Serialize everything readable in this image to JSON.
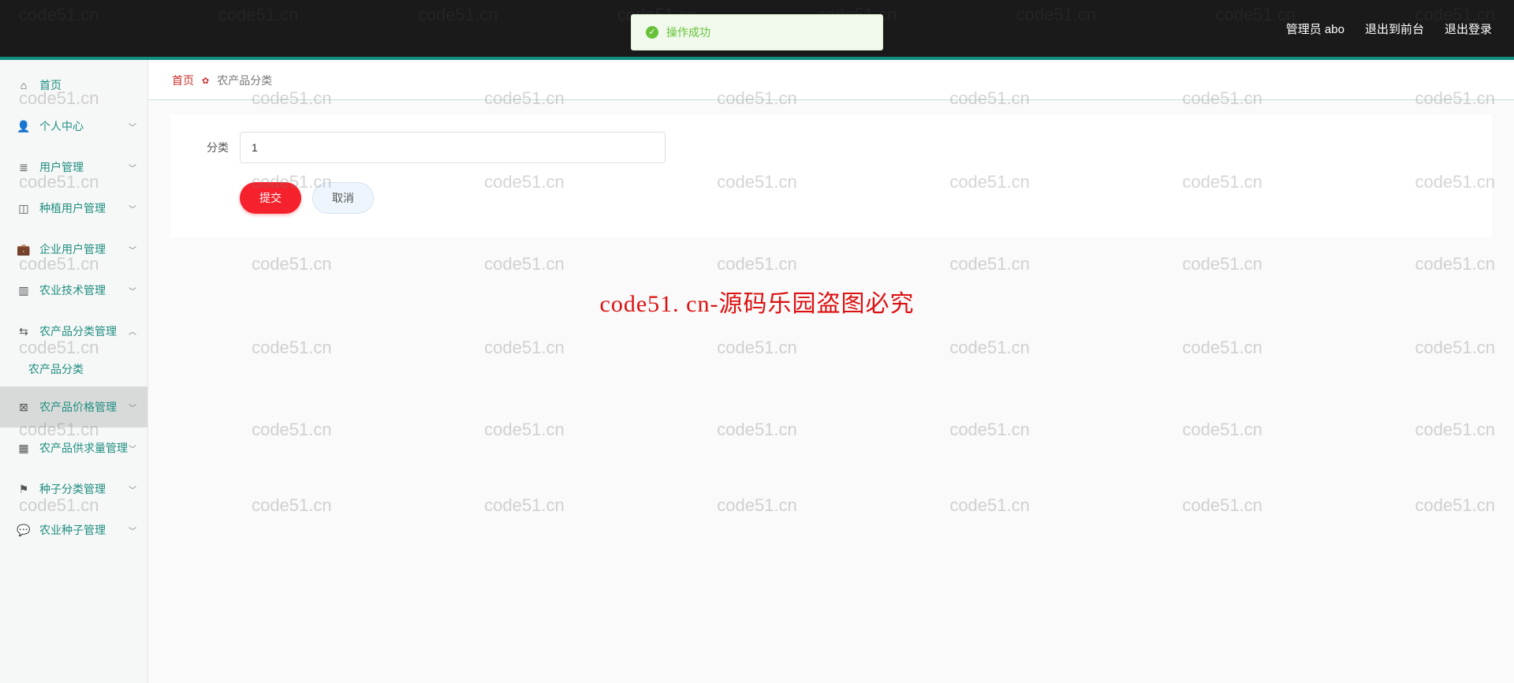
{
  "topbar": {
    "user_label": "管理员 abo",
    "to_front_label": "退出到前台",
    "logout_label": "退出登录"
  },
  "toast": {
    "message": "操作成功"
  },
  "sidebar": {
    "home_label": "首页",
    "items": [
      {
        "icon": "user",
        "label": "个人中心"
      },
      {
        "icon": "list",
        "label": "用户管理"
      },
      {
        "icon": "chart",
        "label": "种植用户管理"
      },
      {
        "icon": "briefcase",
        "label": "企业用户管理"
      },
      {
        "icon": "bars",
        "label": "农业技术管理"
      },
      {
        "icon": "sliders",
        "label": "农产品分类管理",
        "expanded": true,
        "children": [
          {
            "label": "农产品分类"
          }
        ]
      },
      {
        "icon": "close-sq",
        "label": "农产品价格管理",
        "hover": true
      },
      {
        "icon": "grid",
        "label": "农产品供求量管理"
      },
      {
        "icon": "flag",
        "label": "种子分类管理"
      },
      {
        "icon": "comment",
        "label": "农业种子管理"
      }
    ]
  },
  "breadcrumb": {
    "home": "首页",
    "current": "农产品分类"
  },
  "form": {
    "category_label": "分类",
    "category_value": "1",
    "submit_label": "提交",
    "cancel_label": "取消"
  },
  "watermark": {
    "text": "code51.cn",
    "center": "code51. cn-源码乐园盗图必究"
  }
}
